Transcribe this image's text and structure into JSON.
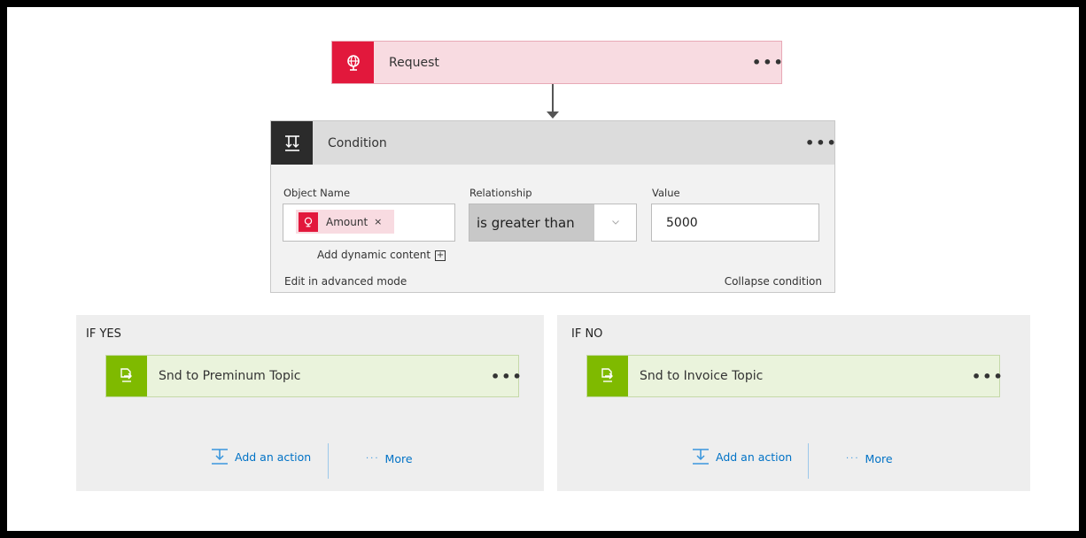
{
  "trigger": {
    "title": "Request",
    "menu": "•••",
    "icon": "request-globe-icon",
    "color": "#e2183c"
  },
  "condition": {
    "title": "Condition",
    "menu": "•••",
    "icon": "condition-icon",
    "object_name_label": "Object Name",
    "object_token": "Amount",
    "object_token_remove": "×",
    "relationship_label": "Relationship",
    "relationship_value": "is greater than",
    "value_label": "Value",
    "value": "5000",
    "add_dynamic_content": "Add dynamic content",
    "add_dynamic_icon": "+",
    "edit_advanced": "Edit in advanced mode",
    "collapse": "Collapse condition"
  },
  "branches": [
    {
      "title": "IF YES",
      "action": {
        "title": "Snd to Preminum Topic",
        "menu": "•••",
        "icon": "service-bus-icon"
      },
      "add_action": "Add an action",
      "more": "More",
      "more_dots": "···"
    },
    {
      "title": "IF NO",
      "action": {
        "title": "Snd to Invoice Topic",
        "menu": "•••",
        "icon": "service-bus-icon"
      },
      "add_action": "Add an action",
      "more": "More",
      "more_dots": "···"
    }
  ],
  "colors": {
    "trigger_accent": "#e2183c",
    "action_accent": "#7fba00",
    "link": "#0072c6"
  }
}
